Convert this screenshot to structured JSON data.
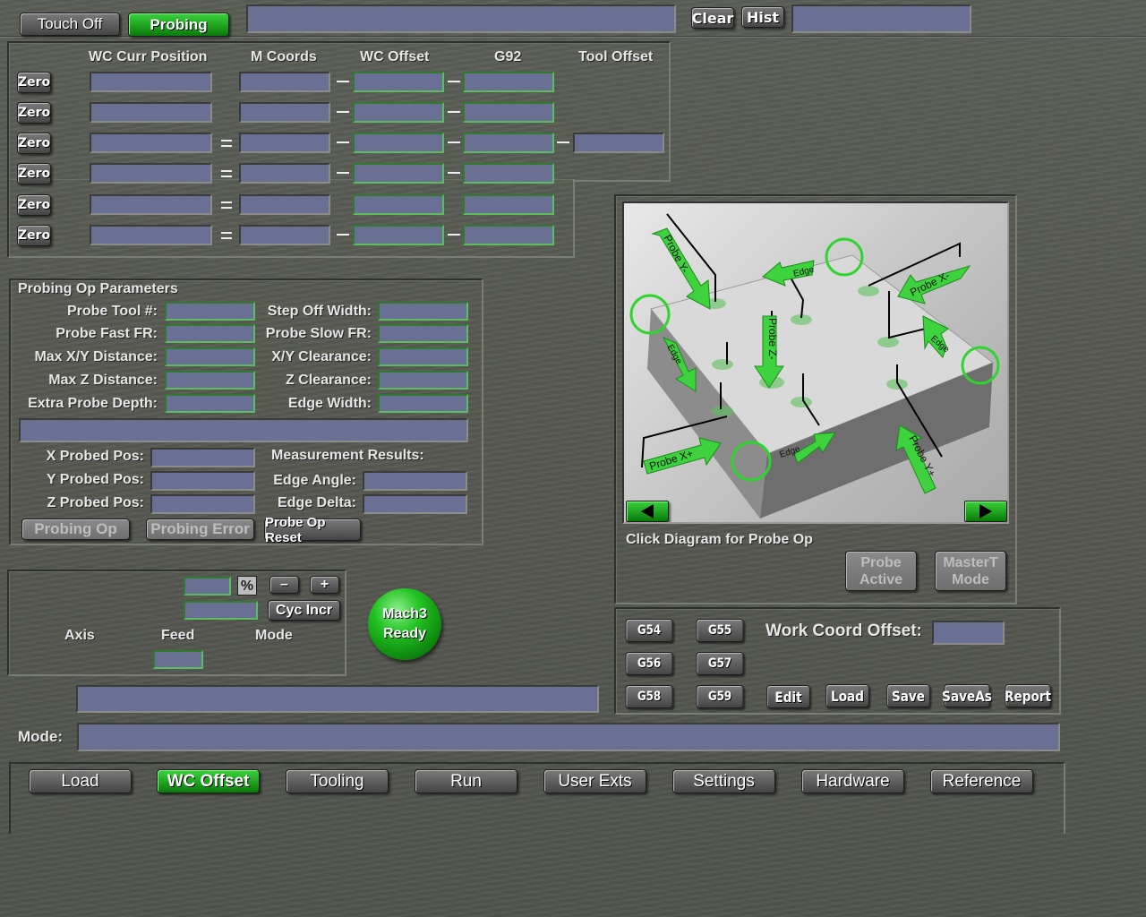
{
  "top_bar": {
    "touch_off": "Touch Off",
    "probing": "Probing",
    "clear": "Clear",
    "hist": "Hist"
  },
  "coords": {
    "headers": {
      "wc_curr_position": "WC Curr Position",
      "m_coords": "M Coords",
      "wc_offset": "WC Offset",
      "g92": "G92",
      "tool_offset": "Tool Offset"
    },
    "zero_label": "Zero",
    "rows": [
      {
        "sep1": "",
        "sep2": "–",
        "sep3": "–"
      },
      {
        "sep1": "",
        "sep2": "–",
        "sep3": "–"
      },
      {
        "sep1": "=",
        "sep2": "–",
        "sep3": "–"
      },
      {
        "sep1": "=",
        "sep2": "–",
        "sep3": "–"
      },
      {
        "sep1": "=",
        "sep2": "",
        "sep3": ""
      },
      {
        "sep1": "=",
        "sep2": "–",
        "sep3": "–"
      }
    ]
  },
  "probing_params": {
    "title": "Probing Op Parameters",
    "probe_tool": "Probe Tool #:",
    "probe_fast_fr": "Probe Fast FR:",
    "max_xy_distance": "Max X/Y Distance:",
    "max_z_distance": "Max Z Distance:",
    "extra_probe_depth": "Extra Probe Depth:",
    "step_off_width": "Step Off Width:",
    "probe_slow_fr": "Probe Slow FR:",
    "xy_clearance": "X/Y Clearance:",
    "z_clearance": "Z Clearance:",
    "edge_width": "Edge Width:",
    "x_probed_pos": "X Probed Pos:",
    "y_probed_pos": "Y Probed Pos:",
    "z_probed_pos": "Z Probed Pos:",
    "measurement_results": "Measurement Results:",
    "edge_angle": "Edge Angle:",
    "edge_delta": "Edge Delta:",
    "probing_op_btn": "Probing Op",
    "probing_error_btn": "Probing Error",
    "probe_op_reset_btn": "Probe Op Reset"
  },
  "jog": {
    "percent": "%",
    "minus": "–",
    "plus": "+",
    "cyc_incr": "Cyc Incr",
    "axis": "Axis",
    "feed": "Feed",
    "mode": "Mode"
  },
  "mach3_status": {
    "line1": "Mach3",
    "line2": "Ready"
  },
  "diagram": {
    "caption": "Click Diagram for Probe Op",
    "labels": {
      "probe_y_minus": "Probe Y-",
      "probe_z_minus": "Probe Z-",
      "probe_x_minus": "Probe X-",
      "probe_x_plus": "Probe X+",
      "probe_y_plus": "Probe Y+",
      "edge": "Edge"
    },
    "probe_active": "Probe Active",
    "mastert_mode": "MasterT Mode"
  },
  "work_coords": {
    "g54": "G54",
    "g55": "G55",
    "g56": "G56",
    "g57": "G57",
    "g58": "G58",
    "g59": "G59",
    "label": "Work Coord Offset:",
    "edit": "Edit",
    "load": "Load",
    "save": "Save",
    "saveas": "SaveAs",
    "report": "Report"
  },
  "mode_label": "Mode:",
  "tabs": [
    {
      "label": "Load",
      "active": false
    },
    {
      "label": "WC Offset",
      "active": true
    },
    {
      "label": "Tooling",
      "active": false
    },
    {
      "label": "Run",
      "active": false
    },
    {
      "label": "User Exts",
      "active": false
    },
    {
      "label": "Settings",
      "active": false
    },
    {
      "label": "Hardware",
      "active": false
    },
    {
      "label": "Reference",
      "active": false
    }
  ],
  "colors": {
    "field_fill": "#6a6f94",
    "active_green": "#17a317",
    "accent_green": "#3ed23e"
  }
}
